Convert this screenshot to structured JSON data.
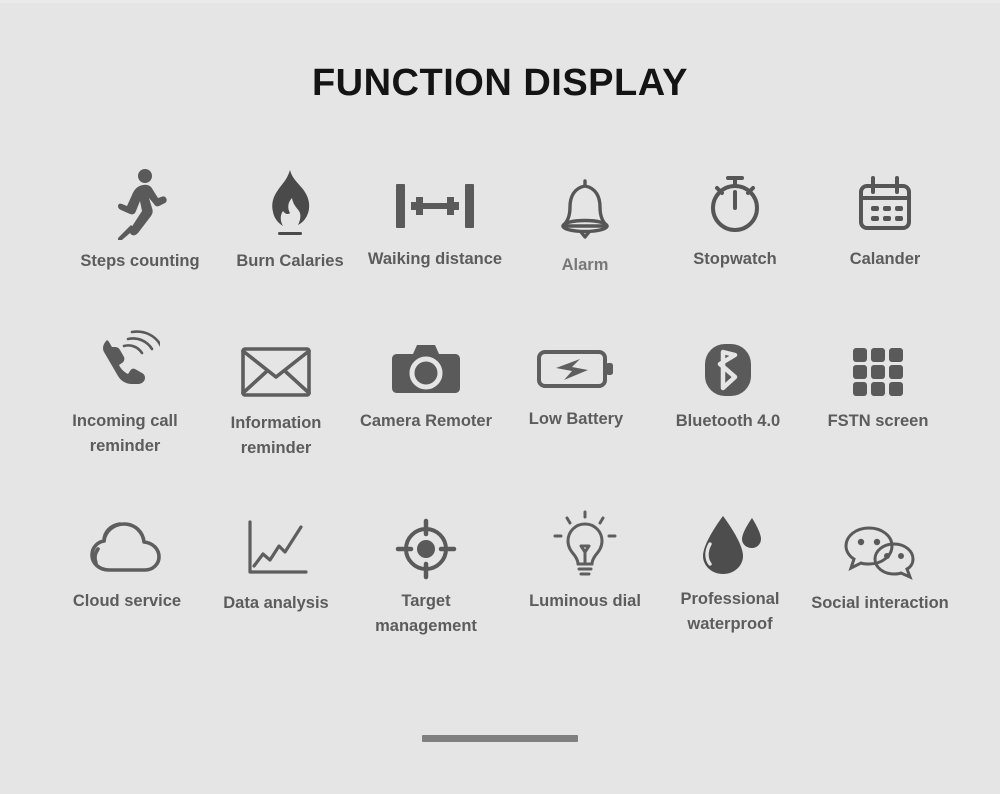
{
  "page": {
    "title": "FUNCTION DISPLAY",
    "background_color": "#e5e5e5",
    "title_color": "#141414",
    "label_color": "#5c5c5c",
    "icon_color": "#5a5a5a",
    "home_bar_color": "#808080"
  },
  "features": [
    {
      "id": "steps-counting",
      "label": "Steps counting",
      "icon": "running-person-icon",
      "row": 1,
      "col": 1
    },
    {
      "id": "burn-calaries",
      "label": "Burn Calaries",
      "icon": "flame-icon",
      "row": 1,
      "col": 2
    },
    {
      "id": "waiking-distance",
      "label": "Waiking distance",
      "icon": "distance-measure-icon",
      "row": 1,
      "col": 3
    },
    {
      "id": "alarm",
      "label": "Alarm",
      "icon": "bell-icon",
      "row": 1,
      "col": 4
    },
    {
      "id": "stopwatch",
      "label": "Stopwatch",
      "icon": "stopwatch-icon",
      "row": 1,
      "col": 5
    },
    {
      "id": "calander",
      "label": "Calander",
      "icon": "calendar-icon",
      "row": 1,
      "col": 6
    },
    {
      "id": "incoming-call-reminder",
      "label": "Incoming call\nreminder",
      "icon": "ringing-phone-icon",
      "row": 2,
      "col": 1
    },
    {
      "id": "information-reminder",
      "label": "Information\nreminder",
      "icon": "envelope-icon",
      "row": 2,
      "col": 2
    },
    {
      "id": "camera-remoter",
      "label": "Camera Remoter",
      "icon": "camera-icon",
      "row": 2,
      "col": 3
    },
    {
      "id": "low-battery",
      "label": "Low Battery",
      "icon": "battery-bolt-icon",
      "row": 2,
      "col": 4
    },
    {
      "id": "bluetooth-40",
      "label": "Bluetooth 4.0",
      "icon": "bluetooth-icon",
      "row": 2,
      "col": 5
    },
    {
      "id": "fstn-screen",
      "label": "FSTN screen",
      "icon": "grid-squares-icon",
      "row": 2,
      "col": 6
    },
    {
      "id": "cloud-service",
      "label": "Cloud service",
      "icon": "cloud-icon",
      "row": 3,
      "col": 1
    },
    {
      "id": "data-analysis",
      "label": "Data analysis",
      "icon": "line-chart-icon",
      "row": 3,
      "col": 2
    },
    {
      "id": "target-management",
      "label": "Target\nmanagement",
      "icon": "crosshair-target-icon",
      "row": 3,
      "col": 3
    },
    {
      "id": "luminous-dial",
      "label": "Luminous dial",
      "icon": "lightbulb-icon",
      "row": 3,
      "col": 4
    },
    {
      "id": "professional-waterproof",
      "label": "Professional\nwaterproof",
      "icon": "water-drop-icon",
      "row": 3,
      "col": 5
    },
    {
      "id": "social-interaction",
      "label": "Social interaction",
      "icon": "chat-bubbles-icon",
      "row": 3,
      "col": 6
    }
  ]
}
